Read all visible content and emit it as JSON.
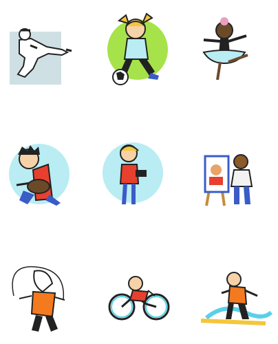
{
  "grid": {
    "items": [
      {
        "icon": "karate-kick-icon"
      },
      {
        "icon": "girl-soccer-icon"
      },
      {
        "icon": "ballerina-icon"
      },
      {
        "icon": "guitarist-icon"
      },
      {
        "icon": "photographer-icon"
      },
      {
        "icon": "child-painter-icon"
      },
      {
        "icon": "jump-rope-icon"
      },
      {
        "icon": "cyclist-icon"
      },
      {
        "icon": "surfer-icon"
      }
    ]
  },
  "colors": {
    "bg_gray": "#cfe0e4",
    "green": "#a6e34a",
    "light_blue": "#b9ecf3",
    "orange": "#f47a1f",
    "red": "#e8402f",
    "blue": "#3a5cc7",
    "yellow": "#f4c63a",
    "skin": "#f6d2a8",
    "dark_skin": "#6b4a2a"
  }
}
